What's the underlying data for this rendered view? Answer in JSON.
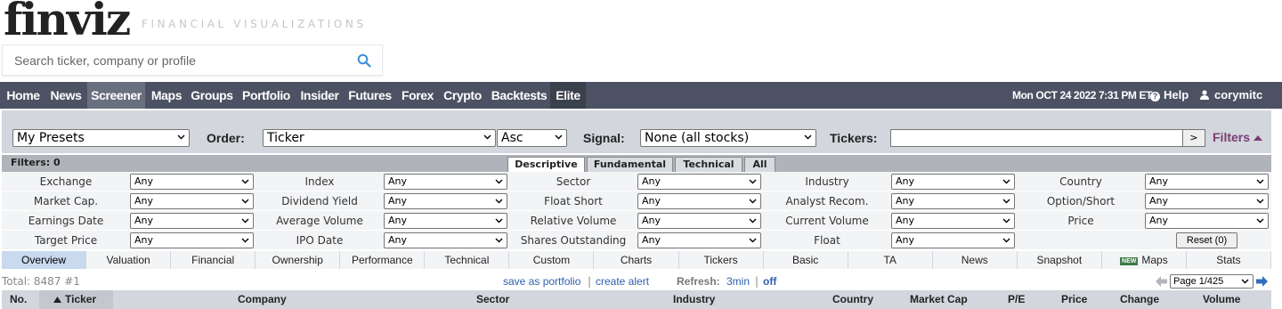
{
  "header": {
    "logo": "finviz",
    "tagline": "FINANCIAL VISUALIZATIONS",
    "search_placeholder": "Search ticker, company or profile"
  },
  "nav": {
    "items": [
      "Home",
      "News",
      "Screener",
      "Maps",
      "Groups",
      "Portfolio",
      "Insider",
      "Futures",
      "Forex",
      "Crypto",
      "Backtests",
      "Elite"
    ],
    "active": "Screener",
    "datetime": "Mon OCT 24 2022 7:31 PM ET",
    "help": "Help",
    "user": "corymitc"
  },
  "controls": {
    "presets": "My Presets",
    "order_label": "Order:",
    "order_value": "Ticker",
    "order_dir": "Asc",
    "signal_label": "Signal:",
    "signal_value": "None (all stocks)",
    "tickers_label": "Tickers:",
    "tickers_value": "",
    "go_label": ">",
    "filters_toggle": "Filters"
  },
  "filters": {
    "count_label": "Filters: 0",
    "tabs": [
      "Descriptive",
      "Fundamental",
      "Technical",
      "All"
    ],
    "active_tab": "Descriptive",
    "rows": [
      [
        {
          "label": "Exchange",
          "value": "Any"
        },
        {
          "label": "Index",
          "value": "Any"
        },
        {
          "label": "Sector",
          "value": "Any"
        },
        {
          "label": "Industry",
          "value": "Any"
        },
        {
          "label": "Country",
          "value": "Any"
        }
      ],
      [
        {
          "label": "Market Cap.",
          "value": "Any"
        },
        {
          "label": "Dividend Yield",
          "value": "Any"
        },
        {
          "label": "Float Short",
          "value": "Any"
        },
        {
          "label": "Analyst Recom.",
          "value": "Any"
        },
        {
          "label": "Option/Short",
          "value": "Any"
        }
      ],
      [
        {
          "label": "Earnings Date",
          "value": "Any"
        },
        {
          "label": "Average Volume",
          "value": "Any"
        },
        {
          "label": "Relative Volume",
          "value": "Any"
        },
        {
          "label": "Current Volume",
          "value": "Any"
        },
        {
          "label": "Price",
          "value": "Any"
        }
      ],
      [
        {
          "label": "Target Price",
          "value": "Any"
        },
        {
          "label": "IPO Date",
          "value": "Any"
        },
        {
          "label": "Shares Outstanding",
          "value": "Any"
        },
        {
          "label": "Float",
          "value": "Any"
        }
      ]
    ],
    "reset_label": "Reset (0)"
  },
  "views": {
    "items": [
      "Overview",
      "Valuation",
      "Financial",
      "Ownership",
      "Performance",
      "Technical",
      "Custom",
      "Charts",
      "Tickers",
      "Basic",
      "TA",
      "News",
      "Snapshot",
      "Maps",
      "Stats"
    ],
    "active": "Overview",
    "new_badge": "NEW"
  },
  "results": {
    "total_label": "Total: 8487 #1",
    "save_portfolio": "save as portfolio",
    "create_alert": "create alert",
    "separator": "|",
    "refresh_label": "Refresh:",
    "refresh_interval": "3min",
    "refresh_off": "off",
    "page": "Page 1/425"
  },
  "table": {
    "columns": [
      "No.",
      "Ticker",
      "Company",
      "Sector",
      "Industry",
      "Country",
      "Market Cap",
      "P/E",
      "Price",
      "Change",
      "Volume"
    ]
  },
  "colors": {
    "nav_bg": "#4c5263",
    "nav_active": "#68707f",
    "panel_bg": "#d3d6dc",
    "link": "#2e5fae",
    "filters_accent": "#7a3c74"
  }
}
